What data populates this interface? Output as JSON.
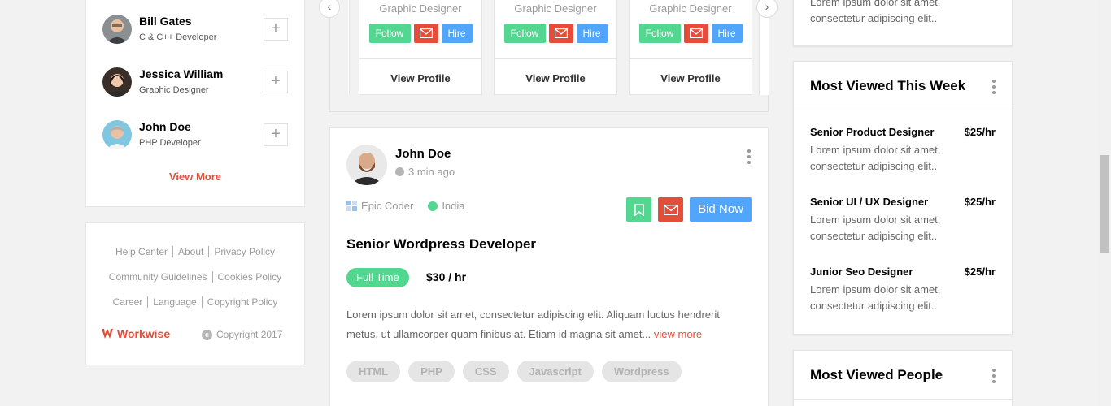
{
  "suggestions": {
    "items": [
      {
        "name": "Bill Gates",
        "role": "C & C++ Developer"
      },
      {
        "name": "Jessica William",
        "role": "Graphic Designer"
      },
      {
        "name": "John Doe",
        "role": "PHP Developer"
      }
    ],
    "add_glyph": "+",
    "view_more": "View More"
  },
  "footer": {
    "row1": [
      "Help Center",
      "About",
      "Privacy Policy"
    ],
    "row2": [
      "Community Guidelines",
      "Cookies Policy"
    ],
    "row3": [
      "Career",
      "Language",
      "Copyright Policy"
    ],
    "brand": "Workwise",
    "copyright": "Copyright 2017",
    "copyright_glyph": "c"
  },
  "carousel": {
    "prev_glyph": "‹",
    "next_glyph": "›",
    "cards": [
      {
        "role": "Graphic Designer",
        "follow": "Follow",
        "hire": "Hire",
        "view_profile": "View Profile"
      },
      {
        "role": "Graphic Designer",
        "follow": "Follow",
        "hire": "Hire",
        "view_profile": "View Profile"
      },
      {
        "role": "Graphic Designer",
        "follow": "Follow",
        "hire": "Hire",
        "view_profile": "View Profile"
      }
    ]
  },
  "post": {
    "author": "John Doe",
    "time": "3 min ago",
    "company": "Epic Coder",
    "location": "India",
    "bid_label": "Bid Now",
    "title": "Senior Wordpress Developer",
    "job_type": "Full Time",
    "rate": "$30 / hr",
    "description": "Lorem ipsum dolor sit amet, consectetur adipiscing elit. Aliquam luctus hendrerit metus, ut ullamcorper quam finibus at. Etiam id magna sit amet...",
    "view_more": "view more",
    "tags": [
      "HTML",
      "PHP",
      "CSS",
      "Javascript",
      "Wordpress"
    ]
  },
  "right": {
    "top_desc": "Lorem ipsum dolor sit amet, consectetur adipiscing elit..",
    "most_viewed_week": {
      "title": "Most Viewed This Week",
      "jobs": [
        {
          "title": "Senior Product Designer",
          "rate": "$25/hr",
          "desc": "Lorem ipsum dolor sit amet, consectetur adipiscing elit.."
        },
        {
          "title": "Senior UI / UX Designer",
          "rate": "$25/hr",
          "desc": "Lorem ipsum dolor sit amet, consectetur adipiscing elit.."
        },
        {
          "title": "Junior Seo Designer",
          "rate": "$25/hr",
          "desc": "Lorem ipsum dolor sit amet, consectetur adipiscing elit.."
        }
      ]
    },
    "most_viewed_people": {
      "title": "Most Viewed People"
    }
  },
  "colors": {
    "accent_red": "#e44d3a",
    "accent_green": "#53d690",
    "accent_blue": "#51a5fb"
  },
  "icons": [
    "plus-icon",
    "mail-icon",
    "bookmark-icon",
    "clock-icon",
    "location-icon",
    "company-icon",
    "more-icon",
    "chevron-left-icon",
    "chevron-right-icon",
    "copyright-icon",
    "workwise-logo"
  ]
}
